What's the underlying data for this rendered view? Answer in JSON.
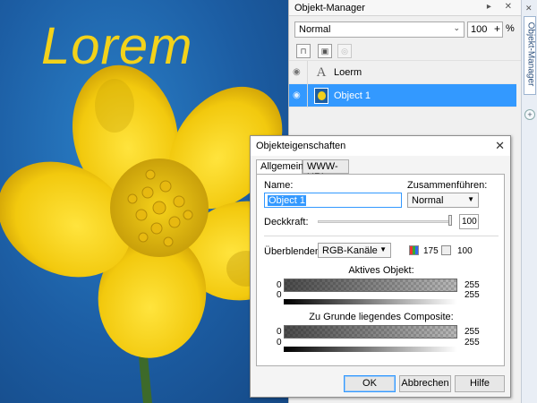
{
  "canvas": {
    "overlay_text": "Lorem",
    "text_color": "#f3d21a",
    "background_color": "#1c5da3",
    "image_subject": "yellow buttercup flower"
  },
  "object_manager": {
    "title": "Objekt-Manager",
    "blend_mode": "Normal",
    "opacity_value": "100",
    "opacity_unit": "%",
    "objects": [
      {
        "label": "Loerm",
        "icon": "text-object-icon",
        "selected": false
      },
      {
        "label": "Object 1",
        "icon": "bitmap-object-icon",
        "selected": true
      }
    ],
    "side_tab_label": "Objekt-Manager"
  },
  "dialog": {
    "title": "Objekteigenschaften",
    "tabs": [
      {
        "label": "Allgemein",
        "active": true
      },
      {
        "label": "WWW-URL",
        "active": false
      }
    ],
    "name_label": "Name:",
    "name_value": "Object 1",
    "merge_label": "Zusammenführen:",
    "merge_value": "Normal",
    "opacity_label": "Deckkraft:",
    "opacity_value": "100",
    "opacity_level": 1.0,
    "blend_label": "Überblenden:",
    "blend_channel": "RGB-Kanäle",
    "blend_num1": "175",
    "blend_num2": "100",
    "active_object_label": "Aktives Objekt:",
    "underlying_label": "Zu Grunde liegendes Composite:",
    "range_min": "0",
    "range_max": "255",
    "buttons": {
      "ok": "OK",
      "cancel": "Abbrechen",
      "help": "Hilfe"
    },
    "accent_color": "#3399ff"
  }
}
